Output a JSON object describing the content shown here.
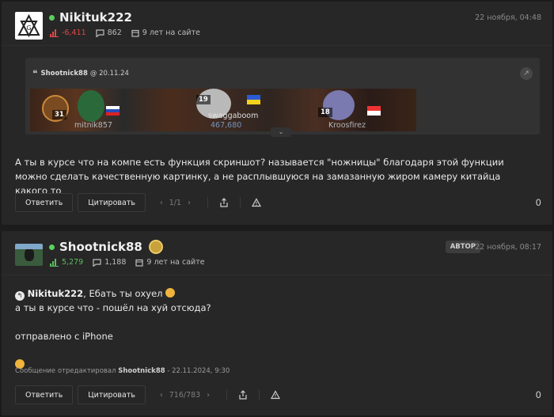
{
  "posts": [
    {
      "username": "Nikituk222",
      "reputation": "-6,411",
      "messages": "862",
      "membership": "9 лет на сайте",
      "date": "22 ноября, 04:48",
      "quote": {
        "author": "Shootnick88",
        "at": "@ 20.11.24",
        "players": [
          {
            "level": "31",
            "name": "mitnik857"
          },
          {
            "level": "19",
            "name": "swaggaboom",
            "score": "467,680"
          },
          {
            "level": "18",
            "name": "Kroosfirez"
          }
        ]
      },
      "text": "А ты в курсе что на компе есть функция скриншот? называется \"ножницы\" благодаря этой функции можно сделать качественную картинку, а не расплывшуюся на замазанную жиром камеру китайца какого то",
      "actions": {
        "reply": "Ответить",
        "quote": "Цитировать",
        "pager": "1/1",
        "count": "0"
      }
    },
    {
      "username": "Shootnick88",
      "author_badge": "АВТОР",
      "reputation": "5,279",
      "messages": "1,188",
      "membership": "9 лет на сайте",
      "date": "22 ноября, 08:17",
      "mention": "Nikituk222",
      "line1_rest": ", Ебать ты охуел",
      "line2": "а ты в курсе что - пошёл на хуй отсюда?",
      "line3": "отправлено с iPhone",
      "edited_prefix": "Сообщение отредактировал",
      "edited_user": "Shootnick88",
      "edited_when": "- 22.11.2024, 9:30",
      "actions": {
        "reply": "Ответить",
        "quote": "Цитировать",
        "pager": "716/783",
        "count": "0"
      }
    }
  ]
}
